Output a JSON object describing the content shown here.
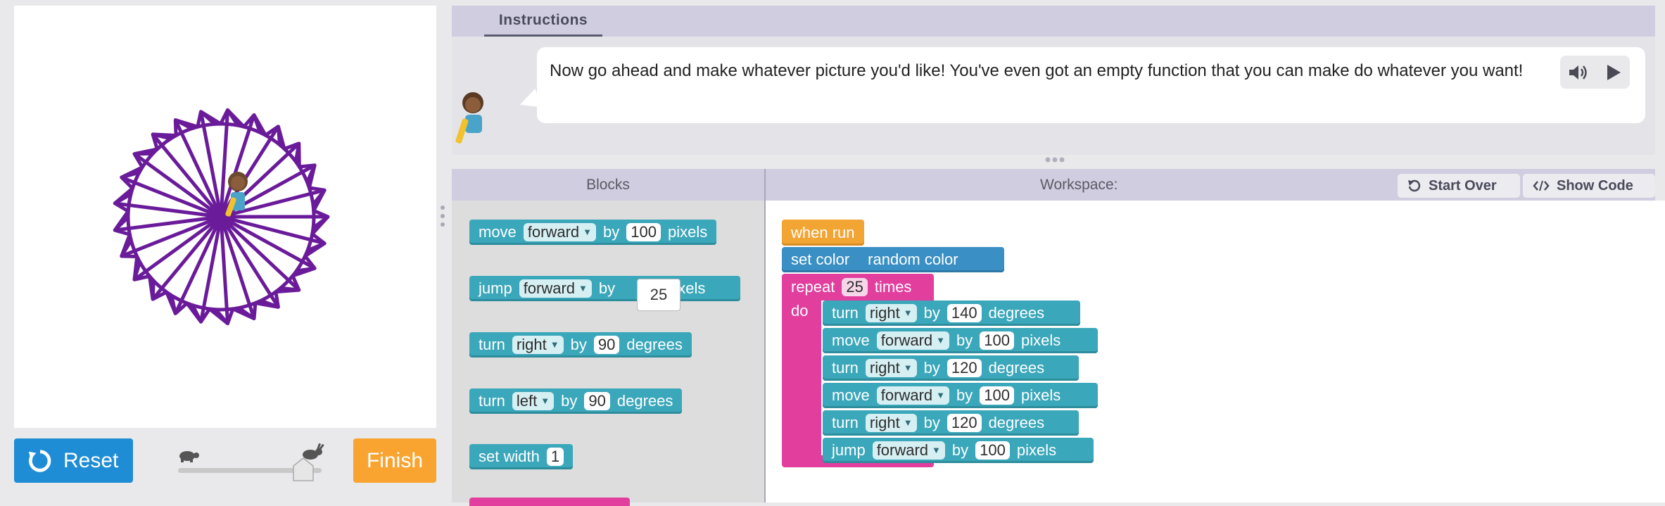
{
  "left_panel": {
    "reset_label": "Reset",
    "finish_label": "Finish"
  },
  "instructions": {
    "tab_label": "Instructions",
    "text": "Now go ahead and make whatever picture you'd like! You've even got an empty function that you can make do whatever you want!"
  },
  "toolbox": {
    "header": "Blocks",
    "blocks": [
      {
        "verb": "move",
        "dir": "forward",
        "by": "by",
        "value": "100",
        "unit": "pixels"
      },
      {
        "verb": "jump",
        "dir": "forward",
        "by": "by",
        "value": "25",
        "unit": "pixels"
      },
      {
        "verb": "turn",
        "dir": "right",
        "by": "by",
        "value": "90",
        "unit": "degrees"
      },
      {
        "verb": "turn",
        "dir": "left",
        "by": "by",
        "value": "90",
        "unit": "degrees"
      },
      {
        "verb": "set width",
        "value": "1"
      }
    ]
  },
  "workspace": {
    "header": "Workspace:",
    "start_over_label": "Start Over",
    "show_code_label": "Show Code",
    "program": {
      "when_run": "when run",
      "set_color": "set color",
      "set_color_value": "random color",
      "repeat": "repeat",
      "repeat_count": "25",
      "times": "times",
      "do": "do",
      "body": [
        {
          "verb": "turn",
          "dir": "right",
          "by": "by",
          "value": "140",
          "unit": "degrees"
        },
        {
          "verb": "move",
          "dir": "forward",
          "by": "by",
          "value": "100",
          "unit": "pixels"
        },
        {
          "verb": "turn",
          "dir": "right",
          "by": "by",
          "value": "120",
          "unit": "degrees"
        },
        {
          "verb": "move",
          "dir": "forward",
          "by": "by",
          "value": "100",
          "unit": "pixels"
        },
        {
          "verb": "turn",
          "dir": "right",
          "by": "by",
          "value": "120",
          "unit": "degrees"
        },
        {
          "verb": "jump",
          "dir": "forward",
          "by": "by",
          "value": "100",
          "unit": "pixels"
        }
      ]
    }
  },
  "colors": {
    "drawing_stroke": "#6a1b9a",
    "reset": "#1f8dd6",
    "finish": "#f9a431",
    "teal_block": "#3ba7ba",
    "pink_block": "#e23e9e",
    "orange_block": "#f3a534",
    "blue_block": "#3a8fc5"
  },
  "icons": [
    "reset-icon",
    "turtle-icon",
    "rabbit-icon",
    "speaker-icon",
    "play-icon",
    "undo-icon",
    "code-icon",
    "artist-character-icon"
  ]
}
